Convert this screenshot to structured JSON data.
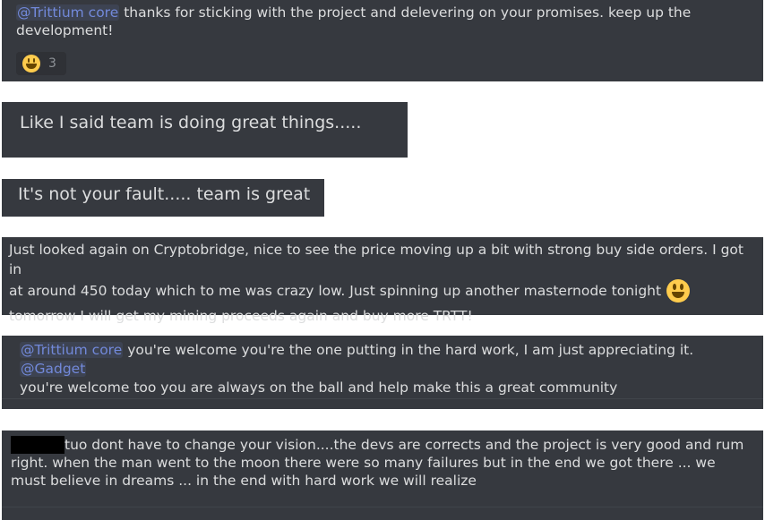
{
  "messages": [
    {
      "mention": "@Trittium core",
      "text": " thanks for sticking with the project and delevering on your promises. keep up the development!",
      "reaction": {
        "icon": "smiley-emoji",
        "count": "3"
      }
    },
    {
      "text": "Like I said team is doing great things....."
    },
    {
      "text": "It's not your fault..... team is great"
    },
    {
      "line1": "Just looked again on Cryptobridge, nice to see the price moving up a bit with strong buy side orders. I got in",
      "line2": "at around 450 today which to me was crazy low.  Just spinning up another masternode tonight",
      "line3": "tomorrow I will get my mining proceeds again and buy more TRTT!",
      "emoji": "smiley-emoji"
    },
    {
      "mention1": "@Trittium core",
      "text1": " you're welcome you're the one putting in the hard work, I am just appreciating it. ",
      "mention2": "@Gadget",
      "text2": "you're welcome too you are always on the ball and help make this a great community"
    },
    {
      "text": "tuo dont have to change your vision....the devs are corrects and the project is very good  and rum right. when the man went to the moon there were so many failures but in the end we got there ... we must believe in dreams ... in the end with hard work we will realize"
    }
  ],
  "colors": {
    "card": "#36393f",
    "text": "#dcddde",
    "mention": "#7289da",
    "emoji": "#ffcc4d"
  }
}
